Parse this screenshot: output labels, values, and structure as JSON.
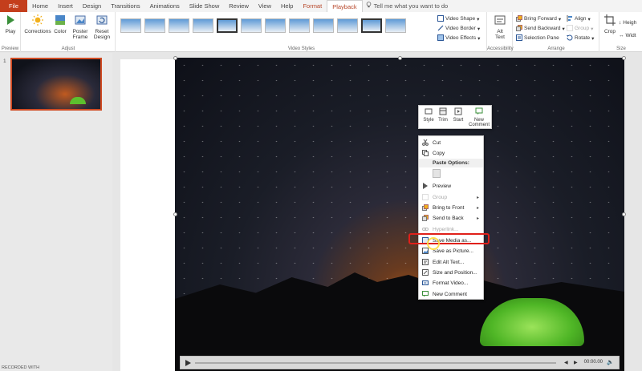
{
  "tabs": [
    "File",
    "Home",
    "Insert",
    "Design",
    "Transitions",
    "Animations",
    "Slide Show",
    "Review",
    "View",
    "Help",
    "Format",
    "Playback"
  ],
  "tell_me": "Tell me what you want to do",
  "ribbon": {
    "preview": {
      "play": "Play",
      "label": "Preview"
    },
    "adjust": {
      "corrections": "Corrections",
      "color": "Color",
      "poster": "Poster Frame",
      "reset": "Reset Design",
      "label": "Adjust"
    },
    "video_styles": {
      "label": "Video Styles",
      "shape": "Video Shape",
      "border": "Video Border",
      "effects": "Video Effects"
    },
    "accessibility": {
      "alt_text": "Alt Text",
      "label": "Accessibility"
    },
    "arrange": {
      "bring_forward": "Bring Forward",
      "send_backward": "Send Backward",
      "selection_pane": "Selection Pane",
      "align": "Align",
      "group": "Group",
      "rotate": "Rotate",
      "label": "Arrange"
    },
    "size": {
      "crop": "Crop",
      "height": "Heigh",
      "width": "Widt",
      "label": "Size"
    }
  },
  "slide_number": "1",
  "mini_toolbar": [
    "Style",
    "Trim",
    "Start",
    "New Comment"
  ],
  "context_menu": {
    "cut": "Cut",
    "copy": "Copy",
    "paste_options": "Paste Options:",
    "preview": "Preview",
    "group": "Group",
    "bring_to_front": "Bring to Front",
    "send_to_back": "Send to Back",
    "hyperlink": "Hyperlink...",
    "save_media": "Save Media as...",
    "save_picture": "Save as Picture...",
    "alt_text": "Edit Alt Text...",
    "size_position": "Size and Position...",
    "format_video": "Format Video...",
    "new_comment": "New Comment"
  },
  "player": {
    "time": "00:00.00"
  },
  "watermark": "RECORDED WITH",
  "colors": {
    "accent": "#b7472a",
    "file_tab": "#c43e1c",
    "highlight": "#e0201a"
  }
}
